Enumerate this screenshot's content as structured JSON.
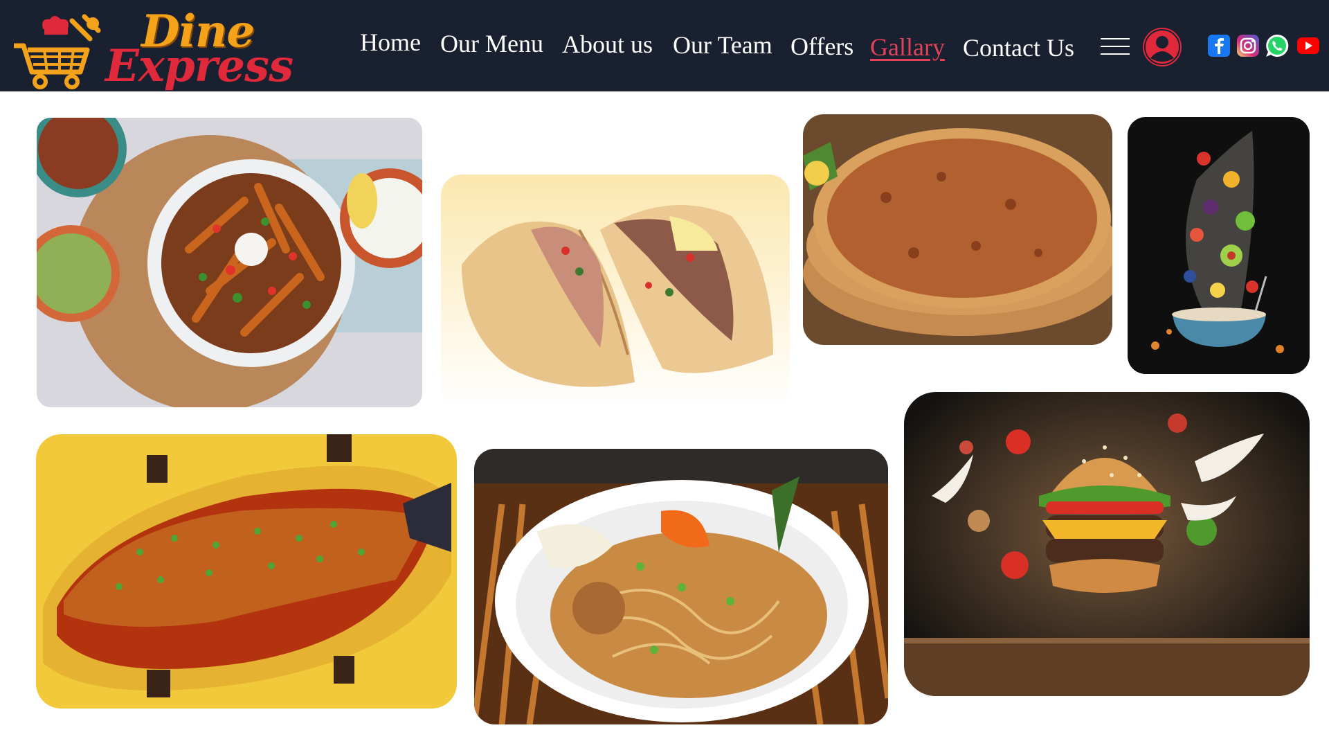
{
  "brand": {
    "name_line1": "Dine",
    "name_line2": "Express",
    "logo_icon": "chef-cart-icon"
  },
  "nav": {
    "items": [
      {
        "label": "Home",
        "active": false
      },
      {
        "label": "Our Menu",
        "active": false
      },
      {
        "label": "About us",
        "active": false
      },
      {
        "label": "Our Team",
        "active": false
      },
      {
        "label": "Offers",
        "active": false
      },
      {
        "label": "Gallary",
        "active": true
      },
      {
        "label": "Contact Us",
        "active": false
      }
    ],
    "menu_icon": "hamburger-menu-icon",
    "user_icon": "user-account-icon"
  },
  "social": [
    "facebook-icon",
    "instagram-icon",
    "whatsapp-icon",
    "youtube-icon"
  ],
  "gallery": {
    "photos": [
      {
        "subject": "sweet-potato-fries-bowl"
      },
      {
        "subject": "wraps"
      },
      {
        "subject": "lahmacun-flatbread"
      },
      {
        "subject": "fruit-splash-bowl"
      },
      {
        "subject": "glazed-fish-platter"
      },
      {
        "subject": "pad-thai-noodles"
      },
      {
        "subject": "floating-burger"
      }
    ]
  },
  "colors": {
    "nav_bg": "#19202f",
    "accent_red": "#e0293a",
    "active_link": "#e0435a",
    "brand_orange": "#f5a21b",
    "nav_text": "#ffffff"
  }
}
